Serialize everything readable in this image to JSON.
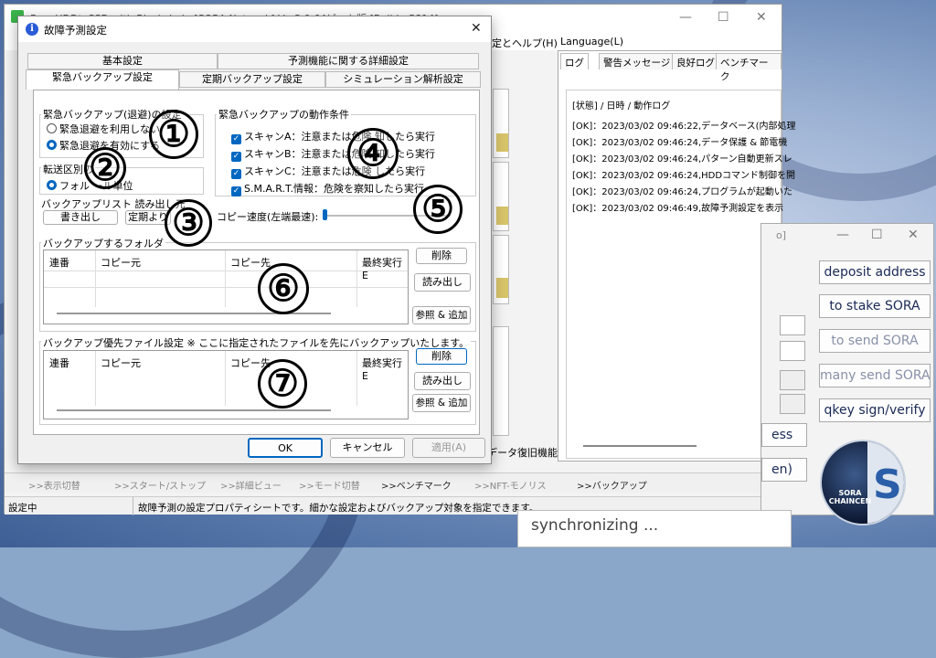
{
  "main": {
    "title": "FromHDDtoSSD with Blockchain [SORA Network] Ver3.0.64ビット版 [Build : 5814]",
    "menu": {
      "help": "定とヘルプ(H)",
      "language": "Language(L)"
    },
    "log_tabs": [
      "ログ",
      "警告メッセージ",
      "良好ログ",
      "ベンチマーク"
    ],
    "log_header": "[状態] / 日時 / 動作ログ",
    "log_lines": [
      "[OK]：2023/03/02 09:46:22,データベース(内部処理",
      "[OK]：2023/03/02 09:46:24,データ保護 & 節電機",
      "[OK]：2023/03/02 09:46:24,パターン自動更新スレ",
      "[OK]：2023/03/02 09:46:24,HDDコマンド制御を開",
      "[OK]：2023/03/02 09:46:24,プログラムが起動いた",
      "[OK]：2023/03/02 09:46:49,故障予測設定を表示"
    ],
    "restore_text": "データ復旧機能",
    "nav": [
      ">>表示切替",
      ">>スタート/ストップ",
      ">>詳細ビュー",
      ">>モード切替",
      ">>ベンチマーク",
      ">>NFT-モノリス",
      ">>バックアップ"
    ],
    "status_left": "設定中",
    "status_msg": "故障予測の設定プロパティシートです。細かな設定およびバックアップ対象を指定できます。"
  },
  "right": {
    "title_frag": "o]",
    "buttons": [
      "deposit address",
      "to stake SORA",
      "to send SORA",
      "many send SORA",
      "qkey sign/verify"
    ],
    "partial": [
      "ess",
      "en)"
    ],
    "sync": "synchronizing ...",
    "logo_text": "SORA CHAINCEN"
  },
  "dialog": {
    "title": "故障予測設定",
    "tabs_row1": [
      "基本設定",
      "予測機能に関する詳細設定"
    ],
    "tabs_row2": [
      "緊急バックアップ設定",
      "定期バックアップ設定",
      "シミュレーション解析設定"
    ],
    "grp_emergency": "緊急バックアップ(退避)の設定",
    "radio1": "緊急退避を利用しない",
    "radio2": "緊急退避を有効にする",
    "grp_transfer": "転送区別の",
    "transfer_opt": "フォル  ール単位",
    "grp_list": "バックアップリスト  読み出し元",
    "btn_export": "書き出し",
    "btn_from_periodic": "定期より",
    "grp_conditions": "緊急バックアップの動作条件",
    "cond": [
      "スキャンA：注意または危険  知したら実行",
      "スキャンB：注意または危険  知したら実行",
      "スキャンC：注意または危険  したら実行",
      "S.M.A.R.T.情報：危険を察知したら実行"
    ],
    "speed_label": "コピー速度(左端最速):",
    "speed_value": 0,
    "grp_folder": "バックアップするフォルダ",
    "cols": [
      "連番",
      "コピー元",
      "コピー先",
      "最終実行E"
    ],
    "btn_delete": "削除",
    "btn_load": "読み出し",
    "btn_browse": "参照 & 追加",
    "grp_priority": "バックアップ優先ファイル設定 ※ ここに指定されたファイルを先にバックアップいたします。",
    "ok": "OK",
    "cancel": "キャンセル",
    "apply": "適用(A)"
  },
  "markers": [
    "①",
    "②",
    "③",
    "④",
    "⑤",
    "⑥",
    "⑦"
  ]
}
